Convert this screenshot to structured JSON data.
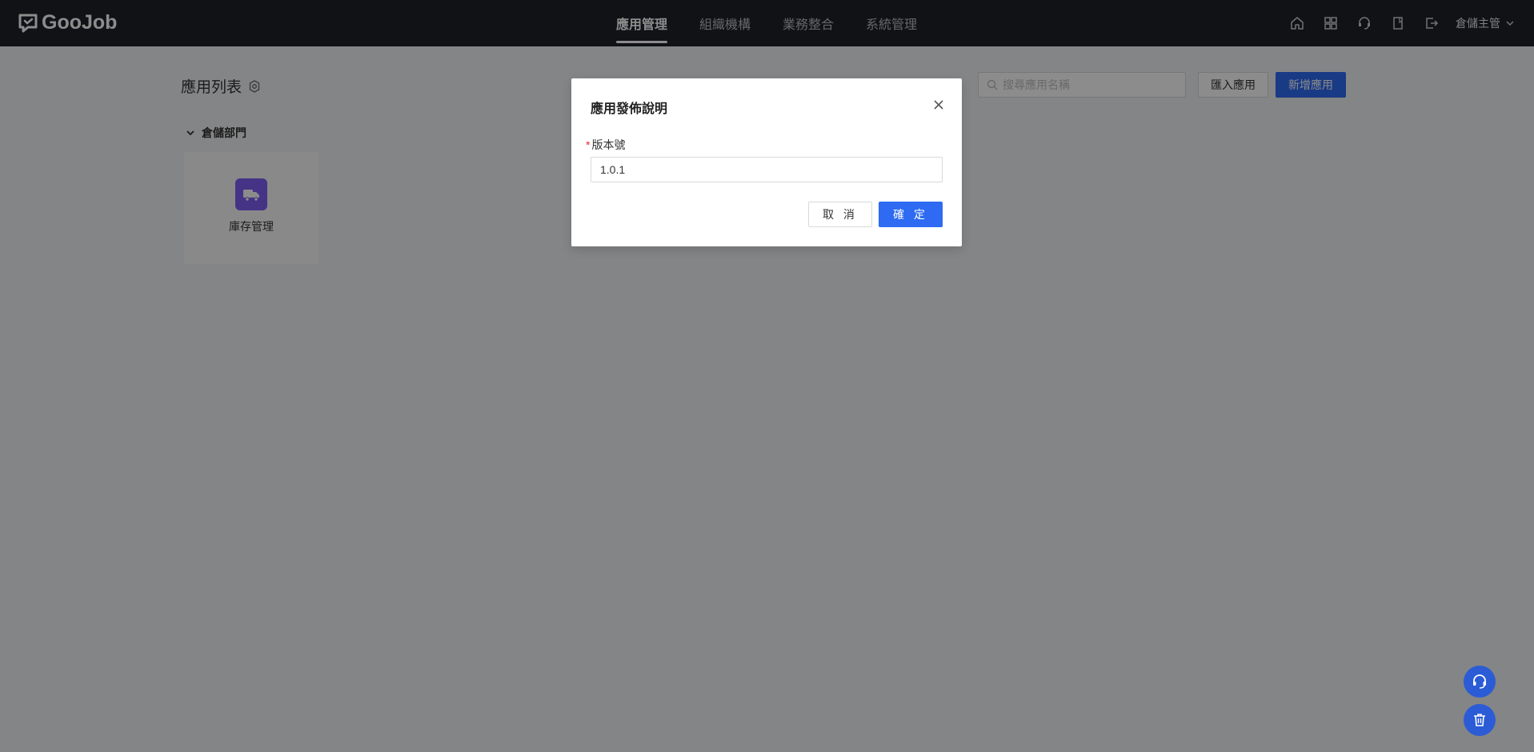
{
  "brand": {
    "name": "GooJob",
    "logo_icon": "chat-bubble-logo-icon"
  },
  "nav": {
    "items": [
      {
        "label": "應用管理",
        "active": true
      },
      {
        "label": "組織機構",
        "active": false
      },
      {
        "label": "業務整合",
        "active": false
      },
      {
        "label": "系統管理",
        "active": false
      }
    ]
  },
  "topbar": {
    "icons": [
      "home-icon",
      "grid-icon",
      "support-icon",
      "book-icon",
      "logout-icon"
    ],
    "user": "倉儲主管"
  },
  "page": {
    "title": "應用列表",
    "search_placeholder": "搜尋應用名稱",
    "import_label": "匯入應用",
    "add_label": "新增應用"
  },
  "group": {
    "name": "倉儲部門",
    "apps": [
      {
        "name": "庫存管理",
        "icon": "truck-icon",
        "color": "#7e5ef4"
      }
    ]
  },
  "modal": {
    "title": "應用發佈說明",
    "field_label": "版本號",
    "field_value": "1.0.1",
    "cancel_label": "取 消",
    "ok_label": "確 定"
  },
  "colors": {
    "primary": "#2e6bf2",
    "topbar": "#1f2128",
    "app_icon": "#7e5ef4"
  }
}
